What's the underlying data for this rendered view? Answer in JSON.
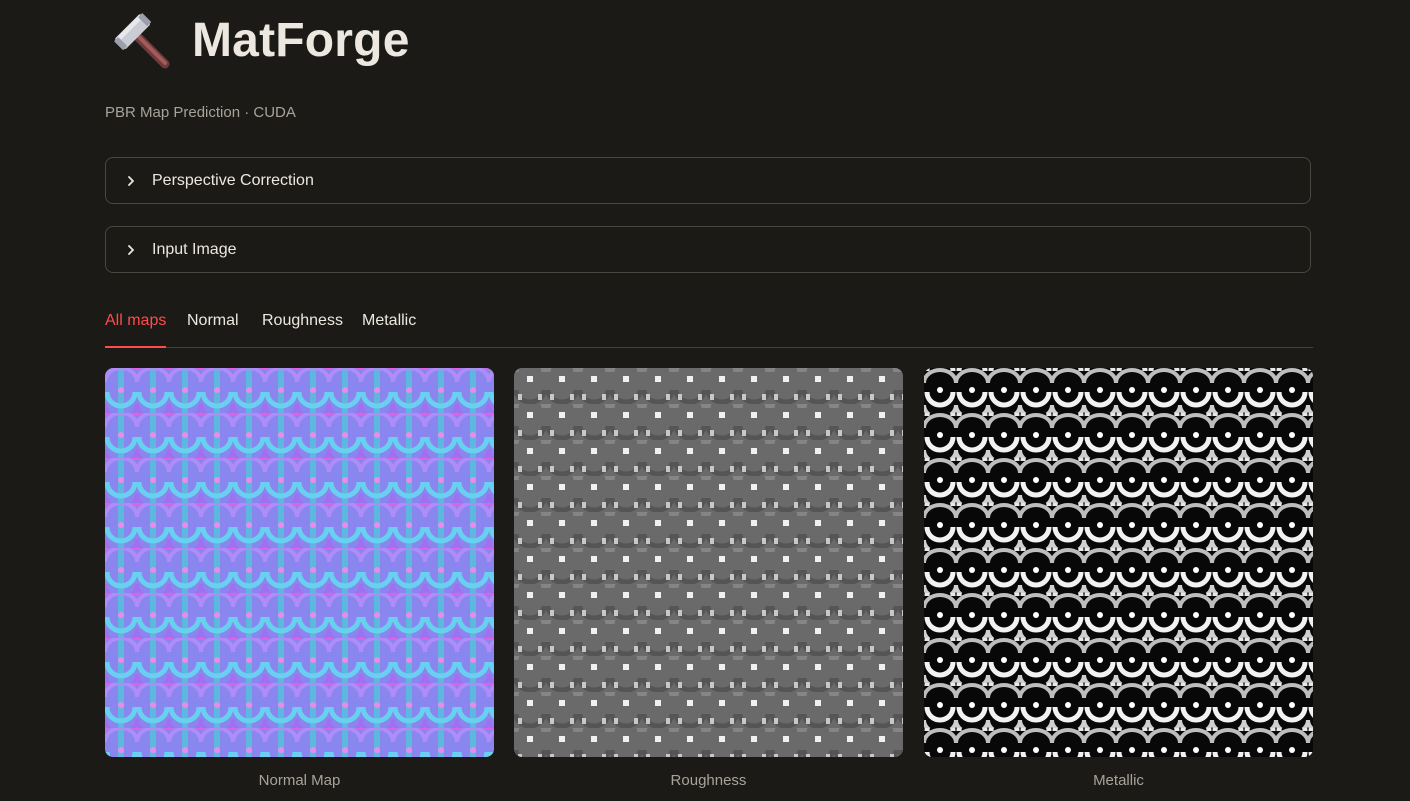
{
  "app": {
    "title": "MatForge",
    "subtitle": "PBR Map Prediction · CUDA",
    "icon": "hammer-icon"
  },
  "expanders": [
    {
      "label": "Perspective Correction",
      "expanded": false
    },
    {
      "label": "Input Image",
      "expanded": false
    }
  ],
  "tabs": [
    {
      "label": "All maps",
      "active": true
    },
    {
      "label": "Normal",
      "active": false
    },
    {
      "label": "Roughness",
      "active": false
    },
    {
      "label": "Metallic",
      "active": false
    }
  ],
  "maps": [
    {
      "caption": "Normal Map"
    },
    {
      "caption": "Roughness"
    },
    {
      "caption": "Metallic"
    }
  ],
  "colors": {
    "background": "#1c1a17",
    "accent": "#ff4b4b",
    "text": "#ece8e0",
    "muted": "#a8a39a",
    "border": "#4a4741"
  }
}
